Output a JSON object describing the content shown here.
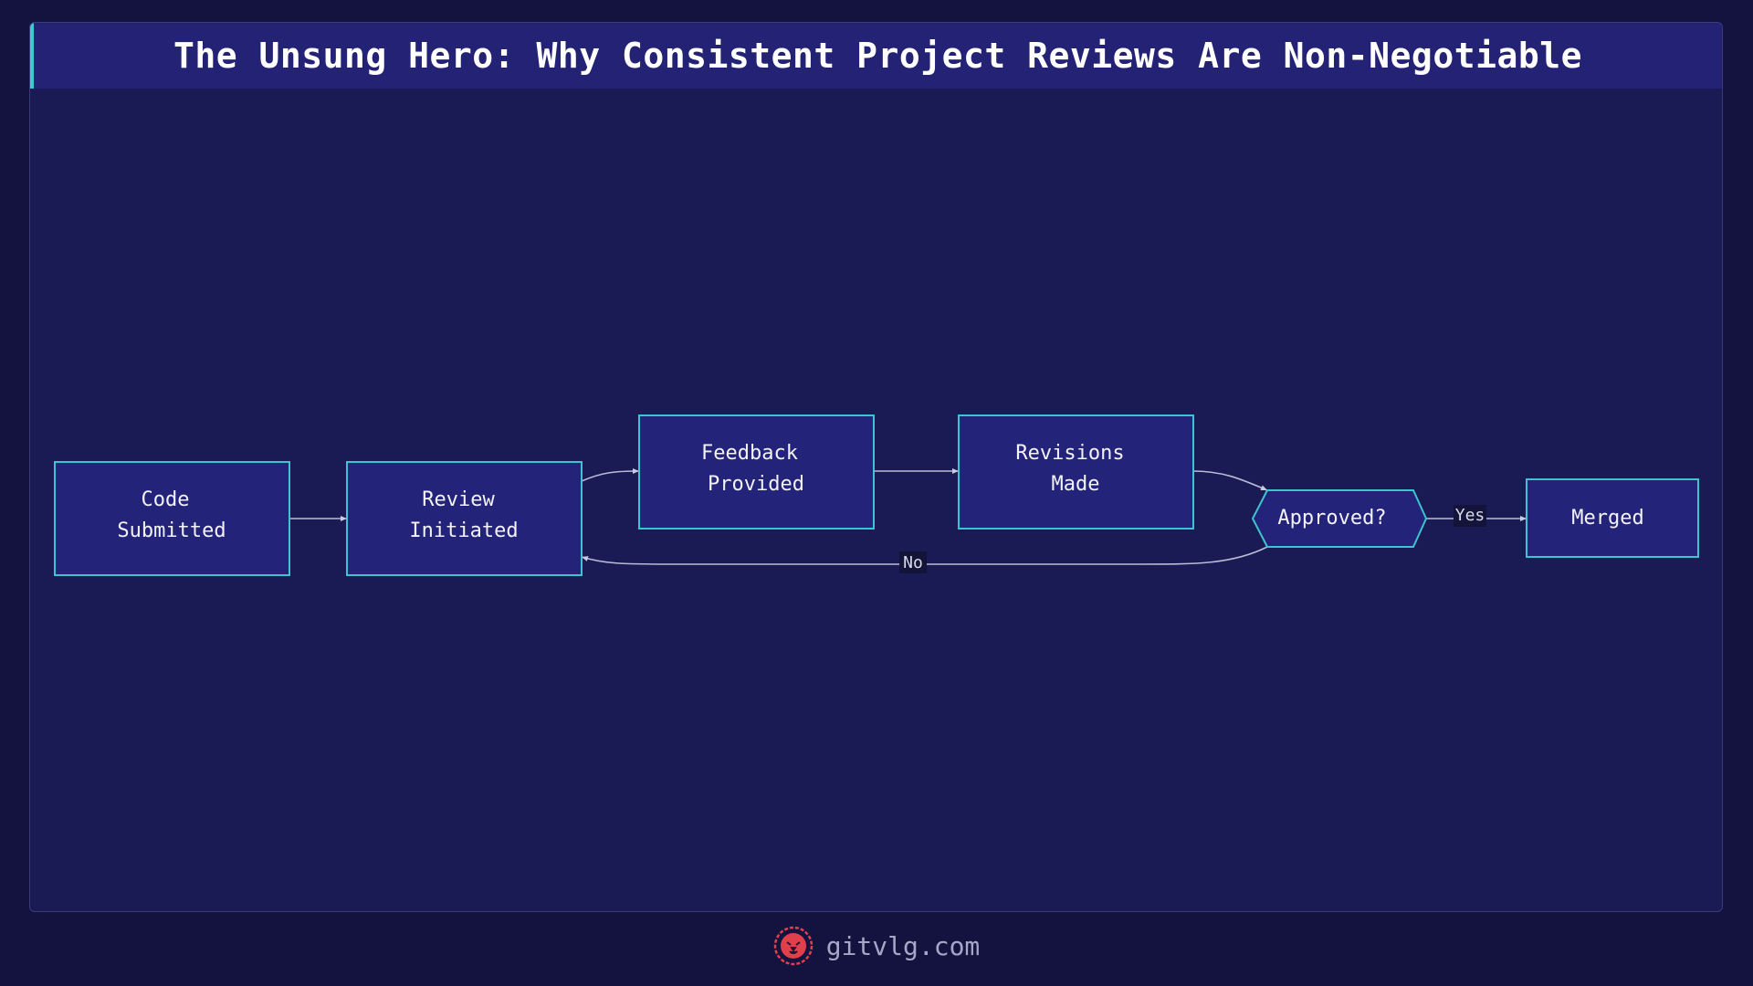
{
  "title": "The Unsung Hero: Why Consistent Project Reviews Are Non-Negotiable",
  "nodes": {
    "code_submitted": [
      "Code",
      "Submitted"
    ],
    "review_initiated": [
      "Review",
      "Initiated"
    ],
    "feedback_provided": [
      "Feedback",
      "Provided"
    ],
    "revisions_made": [
      "Revisions",
      "Made"
    ],
    "approved": [
      "Approved?"
    ],
    "merged": [
      "Merged"
    ]
  },
  "edges": {
    "yes_label": "Yes",
    "no_label": "No"
  },
  "footer": {
    "site": "gitvlg.com",
    "logo_icon": "lion-head-icon"
  },
  "colors": {
    "background": "#14123f",
    "panel": "#1a1a55",
    "title_bar": "#242275",
    "accent": "#40c8d0",
    "node_fill": "#24237a",
    "node_stroke": "#3ec4cc",
    "logo": "#e0404a"
  }
}
